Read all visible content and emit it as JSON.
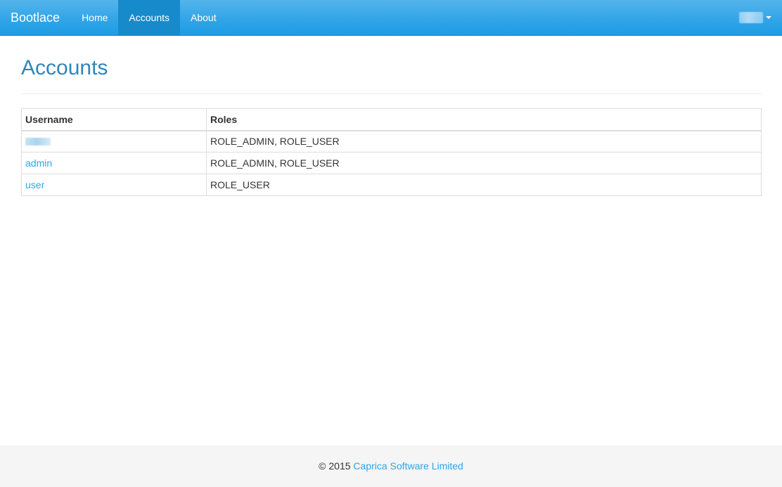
{
  "navbar": {
    "brand": "Bootlace",
    "items": [
      {
        "label": "Home",
        "active": false
      },
      {
        "label": "Accounts",
        "active": true
      },
      {
        "label": "About",
        "active": false
      }
    ],
    "user_menu": {
      "icon": "caret-down-icon"
    }
  },
  "page": {
    "title": "Accounts"
  },
  "table": {
    "headers": [
      "Username",
      "Roles"
    ],
    "rows": [
      {
        "username": "",
        "roles": "ROLE_ADMIN, ROLE_USER"
      },
      {
        "username": "admin",
        "roles": "ROLE_ADMIN, ROLE_USER"
      },
      {
        "username": "user",
        "roles": "ROLE_USER"
      }
    ]
  },
  "footer": {
    "copyright": "© 2015",
    "company": "Caprica Software Limited"
  },
  "colors": {
    "navbar": "#2fa4e7",
    "active_nav": "#178acc",
    "title": "#2f86b8",
    "link": "#2fa4e7",
    "footer_bg": "#f5f5f5"
  }
}
